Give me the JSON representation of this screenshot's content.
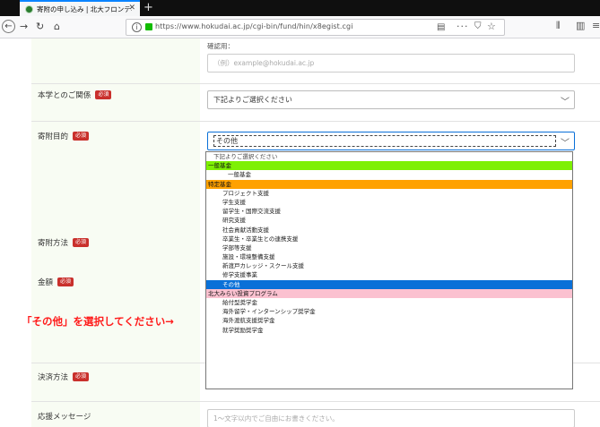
{
  "browser": {
    "tab_title": "寄附の申し込み | 北大フロンティア",
    "url": "https://www.hokudai.ac.jp/cgi-bin/fund/hin/x8egist.cgi"
  },
  "form": {
    "email_confirm": {
      "small_label": "確認用：",
      "placeholder": "（例）example@hokudai.ac.jp"
    },
    "relation": {
      "label": "本学とのご関係",
      "badge": "必須",
      "value": "下記よりご選択ください"
    },
    "purpose": {
      "label": "寄附目的",
      "badge": "必須",
      "value": "その他"
    },
    "method": {
      "label": "寄附方法",
      "badge": "必須"
    },
    "amount": {
      "label": "金額",
      "badge": "必須"
    },
    "payment": {
      "label": "決済方法",
      "badge": "必須"
    },
    "message": {
      "label": "応援メッセージ",
      "placeholder": "1～文字以内でご自由にお書きください。"
    }
  },
  "dropdown_options": [
    {
      "text": "下記よりご選択ください",
      "kind": "placeholder"
    },
    {
      "text": "一般基金",
      "kind": "group",
      "color": "#7ef004"
    },
    {
      "text": "一般基金",
      "kind": "sub"
    },
    {
      "text": "特定基金",
      "kind": "group",
      "color": "#ffa100"
    },
    {
      "text": "プロジェクト支援",
      "kind": "option"
    },
    {
      "text": "学生支援",
      "kind": "option"
    },
    {
      "text": "留学生・国際交流支援",
      "kind": "option"
    },
    {
      "text": "研究支援",
      "kind": "option"
    },
    {
      "text": "社会貢献活動支援",
      "kind": "option"
    },
    {
      "text": "卒業生・卒業生との連携支援",
      "kind": "option"
    },
    {
      "text": "学部等支援",
      "kind": "option"
    },
    {
      "text": "施設・環境整備支援",
      "kind": "option"
    },
    {
      "text": "新渡戸カレッジ・スクール支援",
      "kind": "option"
    },
    {
      "text": "修学支援事業",
      "kind": "option"
    },
    {
      "text": "その他",
      "kind": "option",
      "selected": true
    },
    {
      "text": "北大みらい投資プログラム",
      "kind": "group",
      "color": "#fbc1d0"
    },
    {
      "text": "給付型奨学金",
      "kind": "option"
    },
    {
      "text": "海外留学・インターンシップ奨学金",
      "kind": "option"
    },
    {
      "text": "海外渡航支援奨学金",
      "kind": "option"
    },
    {
      "text": "就学奨励奨学金",
      "kind": "option"
    }
  ],
  "callout": {
    "text": "「その他」を選択してください→",
    "color": "#ff1a1a"
  }
}
